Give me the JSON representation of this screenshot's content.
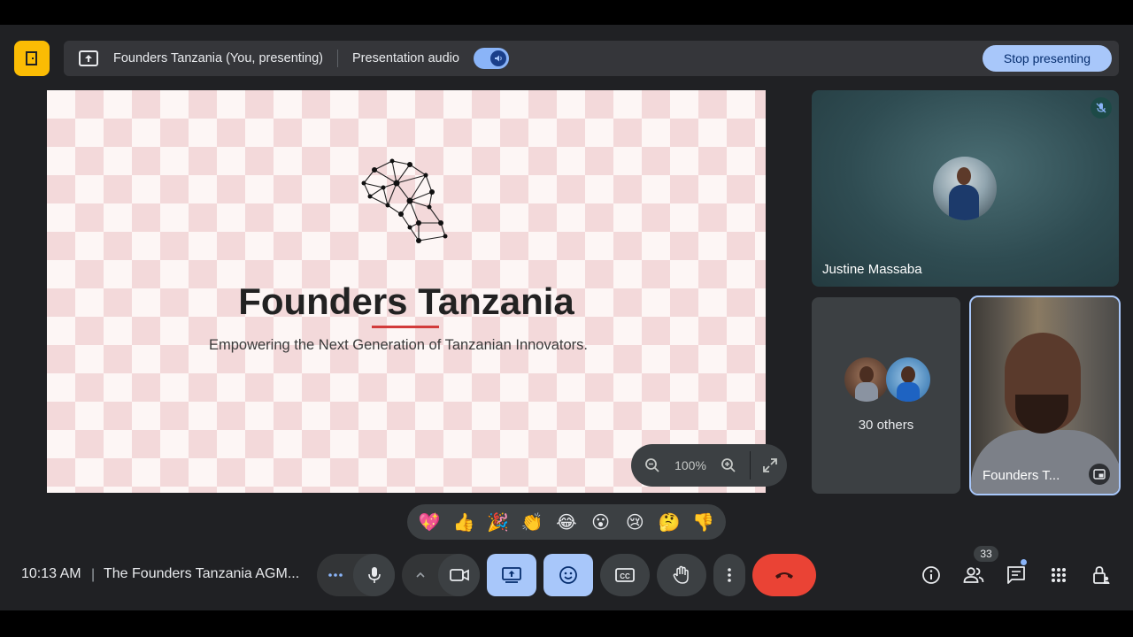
{
  "presenting_bar": {
    "presenter_text": "Founders Tanzania (You, presenting)",
    "audio_label": "Presentation audio",
    "stop_label": "Stop presenting"
  },
  "slide": {
    "title": "Founders Tanzania",
    "subtitle": "Empowering the Next Generation of Tanzanian Innovators."
  },
  "zoom": {
    "value": "100%"
  },
  "participants": {
    "main_name": "Justine Massaba",
    "others_label": "30 others",
    "self_name": "Founders T..."
  },
  "reactions": [
    "💖",
    "👍",
    "🎉",
    "👏",
    "😂",
    "😮",
    "😢",
    "🤔",
    "👎"
  ],
  "bottom": {
    "time": "10:13 AM",
    "separator": "|",
    "meeting_title": "The Founders Tanzania AGM...",
    "people_count": "33"
  },
  "colors": {
    "accent": "#a8c7fa",
    "hangup": "#ea4335",
    "exit_tile": "#fbbc04",
    "background": "#202124"
  }
}
